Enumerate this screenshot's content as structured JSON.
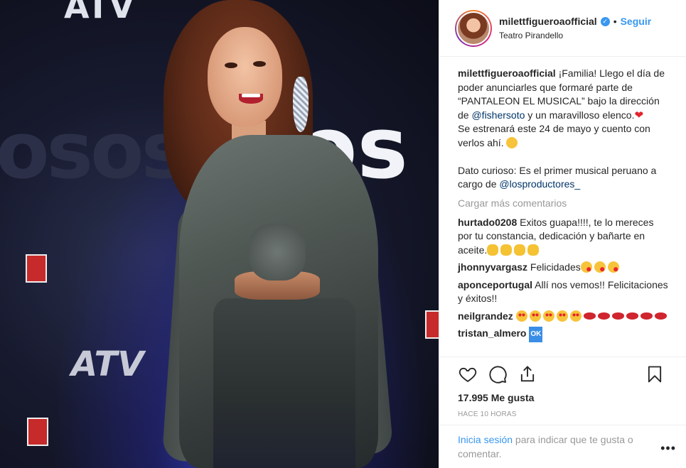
{
  "header": {
    "username": "milettfigueroaofficial",
    "verified_icon": "verified-badge-icon",
    "separator": "•",
    "follow_label": "Seguir",
    "location": "Teatro Pirandello"
  },
  "caption": {
    "username": "milettfigueroaofficial",
    "text_1": " ¡Familia! Llego el día de poder anunciarles que formaré parte de “PANTALEON EL MUSICAL” bajo la dirección de ",
    "mention_1": "@fishersoto",
    "text_2": " y un maravilloso elenco.",
    "text_3": "Se estrenará este 24 de mayo y cuento con verlos ahí. ",
    "text_4": "Dato curioso: Es el primer musical peruano a cargo de ",
    "mention_2": "@losproductores_"
  },
  "load_more": "Cargar más comentarios",
  "comments": [
    {
      "user": "hurtado0208",
      "text": " Exitos guapa!!!!, te lo mereces por tu constancia, dedicación y bañarte en aceite."
    },
    {
      "user": "jhonnyvargasz",
      "text": " Felicidades"
    },
    {
      "user": "aponceportugal",
      "text": " Allí nos vemos!! Felicitaciones y éxitos!!"
    },
    {
      "user": "neilgrandez",
      "text": " "
    },
    {
      "user": "tristan_almero",
      "text": " ",
      "badge": "OK"
    }
  ],
  "actions": {
    "like_icon": "heart-icon",
    "comment_icon": "comment-icon",
    "share_icon": "share-icon",
    "save_icon": "bookmark-icon"
  },
  "likes": {
    "count": "17.995",
    "label": " Me gusta"
  },
  "timestamp": "HACE 10 HORAS",
  "login": {
    "link": "Inicia sesión",
    "text": " para indicar que te gusta o comentar.",
    "more_icon": "more-options-icon"
  },
  "photo": {
    "backdrop_text_1": "osos",
    "backdrop_text_2": "os",
    "backdrop_text_3": "ATV",
    "backdrop_text_4": "ATV"
  },
  "colors": {
    "accent": "#3897f0",
    "text": "#262626",
    "muted": "#999999"
  }
}
